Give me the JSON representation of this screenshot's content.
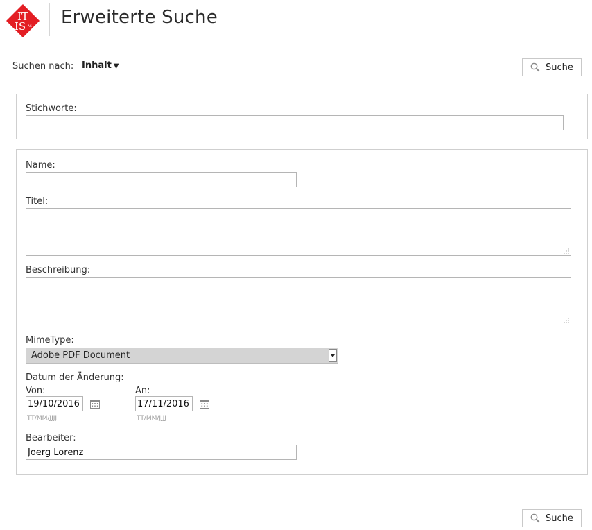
{
  "header": {
    "logo_text_top": "IT",
    "logo_text_bottom": "IS",
    "logo_text_small": "AG",
    "title": "Erweiterte Suche"
  },
  "toolbar": {
    "search_by_label": "Suchen nach:",
    "search_by_value": "Inhalt",
    "search_button_label": "Suche"
  },
  "keywords_panel": {
    "label": "Stichworte:",
    "value": ""
  },
  "meta_panel": {
    "name_label": "Name:",
    "name_value": "",
    "title_label": "Titel:",
    "title_value": "",
    "description_label": "Beschreibung:",
    "description_value": "",
    "mimetype_label": "MimeType:",
    "mimetype_value": "Adobe PDF Document",
    "date_label": "Datum der Änderung:",
    "from_label": "Von:",
    "from_value": "19/10/2016",
    "to_label": "An:",
    "to_value": "17/11/2016",
    "date_format_hint": "TT/MM/JJJJ",
    "editor_label": "Bearbeiter:",
    "editor_value": "Joerg Lorenz"
  },
  "colors": {
    "logo_red": "#e31e24",
    "select_bg": "#d4d4d4",
    "border": "#cfcfcf"
  },
  "icons": {
    "search": "magnifier-icon",
    "calendar": "calendar-icon",
    "dropdown": "caret-down-icon"
  }
}
